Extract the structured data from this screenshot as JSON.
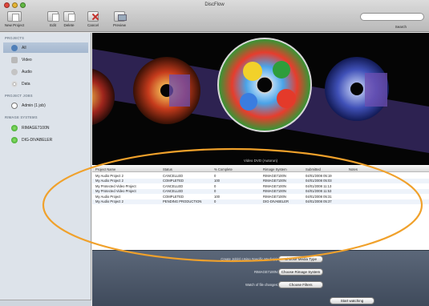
{
  "window": {
    "title": "DiscFlow",
    "search_label": "Search",
    "traffic_colors": {
      "close": "#e0473c",
      "minimize": "#e5b433",
      "zoom": "#62b843"
    }
  },
  "toolbar": {
    "new_project": "New Project",
    "edit": "Edit",
    "delete": "Delete",
    "cancel": "Cancel",
    "preview": "Preview"
  },
  "sidebar": {
    "projects_header": "PROJECTS",
    "projects": [
      {
        "label": "All",
        "icon": "all-icon"
      },
      {
        "label": "Video",
        "icon": "video-icon"
      },
      {
        "label": "Audio",
        "icon": "audio-icon"
      },
      {
        "label": "Data",
        "icon": "disc-icon"
      }
    ],
    "project_jobs_header": "PROJECT JOBS",
    "jobs": [
      {
        "label": "Admin (1 job)",
        "icon": "clock-icon"
      }
    ],
    "rimage_header": "RIMAGE SYSTEMS",
    "systems": [
      {
        "label": "RIMAGE7100N",
        "icon": "status-green-icon"
      },
      {
        "label": "DIG-DIVABELER",
        "icon": "status-green-icon"
      }
    ]
  },
  "banner": {
    "caption": "Video DVD (Autorun)"
  },
  "table": {
    "columns": [
      "Project Name",
      "Status",
      "% Complete",
      "Rimage System",
      "Submitted",
      "Notes"
    ],
    "rows": [
      [
        "My Audio Project 2",
        "CANCELLED",
        "0",
        "RIMAGE7100N",
        "04/01/2008 05:19",
        ""
      ],
      [
        "My Audio Project 2",
        "COMPLETED",
        "100",
        "RIMAGE7100N",
        "04/01/2008 05:03",
        ""
      ],
      [
        "My Protected Video Project",
        "CANCELLED",
        "0",
        "RIMAGE7100N",
        "04/01/2008 11:13",
        ""
      ],
      [
        "My Protected Video Project",
        "CANCELLED",
        "0",
        "RIMAGE7100N",
        "04/01/2008 11:53",
        ""
      ],
      [
        "My Audio Project",
        "COMPLETED",
        "100",
        "RIMAGE7100N",
        "04/01/2008 05:31",
        ""
      ],
      [
        "My Audio Project 2",
        "PENDING PRODUCTION",
        "0",
        "DIG-DIVABELER",
        "04/01/2008 05:37",
        ""
      ]
    ]
  },
  "options": {
    "label_1": "Create Job(s) Using Specific Media(s):",
    "button_1": "Choose Media Type",
    "label_2": "RIMAGE7100N:",
    "button_2": "Choose Rimage System",
    "label_3": "Watch of file changes:",
    "button_3": "Choose Filters",
    "submit": "Start watching"
  },
  "annotation_color": "#f0a12b"
}
